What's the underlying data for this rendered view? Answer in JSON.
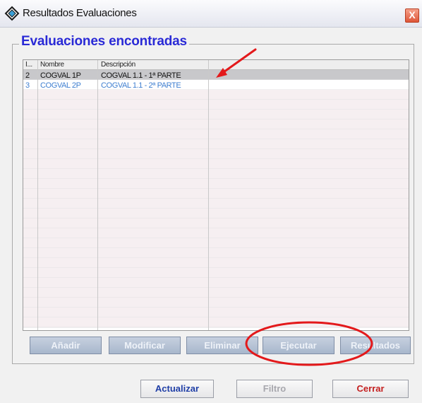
{
  "window": {
    "title": "Resultados Evaluaciones",
    "close_label": "X"
  },
  "group": {
    "title": "Evaluaciones encontradas"
  },
  "grid": {
    "columns": [
      "I...",
      "Nombre",
      "Descripción",
      ""
    ],
    "rows": [
      {
        "id": "2",
        "nombre": "COGVAL 1P",
        "descripcion": "COGVAL 1.1 - 1ª PARTE",
        "selected": true
      },
      {
        "id": "3",
        "nombre": "COGVAL 2P",
        "descripcion": "COGVAL 1.1 - 2ª PARTE",
        "selected": false
      }
    ],
    "colors": {
      "selected_row_bg": "#c8c8cb",
      "blue_text": "#3f7fd0",
      "empty_row_tint": "#f6eff1"
    }
  },
  "actions": {
    "add": "Añadir",
    "modify": "Modificar",
    "delete": "Eliminar",
    "execute": "Ejecutar",
    "results": "Resultados"
  },
  "footer": {
    "refresh": "Actualizar",
    "filter": "Filtro",
    "close": "Cerrar"
  },
  "annotations": {
    "color": "#e3191b",
    "items": [
      "arrow pointing at first row",
      "ellipse around Ejecutar button"
    ]
  },
  "icons": {
    "window": "diamond-app-icon",
    "close": "close-icon"
  }
}
